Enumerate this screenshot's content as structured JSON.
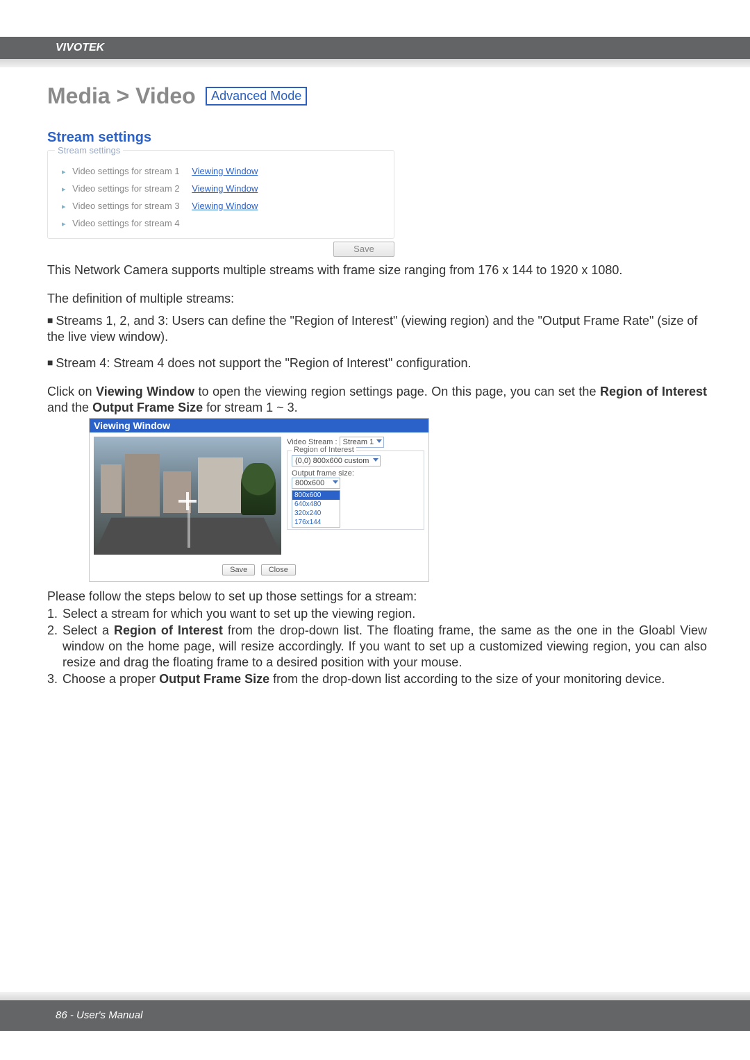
{
  "header": {
    "brand": "VIVOTEK"
  },
  "title": {
    "breadcrumb": "Media > Video",
    "mode_badge": "Advanced Mode"
  },
  "section": {
    "stream_settings_heading": "Stream settings"
  },
  "panel": {
    "legend": "Stream settings",
    "rows": [
      {
        "label": "Video settings for stream 1",
        "link": "Viewing Window"
      },
      {
        "label": "Video settings for stream 2",
        "link": "Viewing Window"
      },
      {
        "label": "Video settings for stream 3",
        "link": "Viewing Window"
      },
      {
        "label": "Video settings for stream 4",
        "link": ""
      }
    ],
    "save_label": "Save"
  },
  "para": {
    "p1": "This Network Camera supports multiple streams with frame size ranging from 176 x 144 to 1920 x 1080.",
    "p2": "The definition of multiple streams:",
    "b1": "Streams 1, 2, and 3: Users can define the \"Region of Interest\" (viewing region) and the \"Output Frame Rate\" (size of the live view window).",
    "b2": "Stream 4: Stream 4 does not support the \"Region of Interest\" configuration.",
    "p3a": "Click on ",
    "p3b": "Viewing Window",
    "p3c": " to open the viewing region settings page. On this page, you can set the ",
    "p3d": "Region of Interest",
    "p3e": " and the ",
    "p3f": "Output Frame Size",
    "p3g": " for stream 1 ~ 3.",
    "steps_intro": "Please follow the steps below to set up those settings for a stream:",
    "s1": "Select a stream for which you want to set up the viewing region.",
    "s2a": "Select a ",
    "s2b": "Region of Interest",
    "s2c": " from the drop-down list. The floating frame, the same as the one in the Gloabl View window on the home page, will resize accordingly. If you want to set up a customized viewing region, you can also resize and drag the floating frame to a desired position with your mouse.",
    "s3a": "Choose a proper ",
    "s3b": "Output Frame Size",
    "s3c": " from the drop-down list according to the size of your monitoring device."
  },
  "viewing_window": {
    "title": "Viewing Window",
    "video_stream_label": "Video Stream :",
    "video_stream_value": "Stream 1",
    "roi_legend": "Region of Interest",
    "roi_value": "(0,0) 800x600 custom",
    "ofs_label": "Output frame size:",
    "ofs_selected": "800x600",
    "ofs_options": [
      "800x600",
      "640x480",
      "320x240",
      "176x144"
    ],
    "save_label": "Save",
    "close_label": "Close"
  },
  "footer": {
    "text": "86 - User's Manual"
  }
}
